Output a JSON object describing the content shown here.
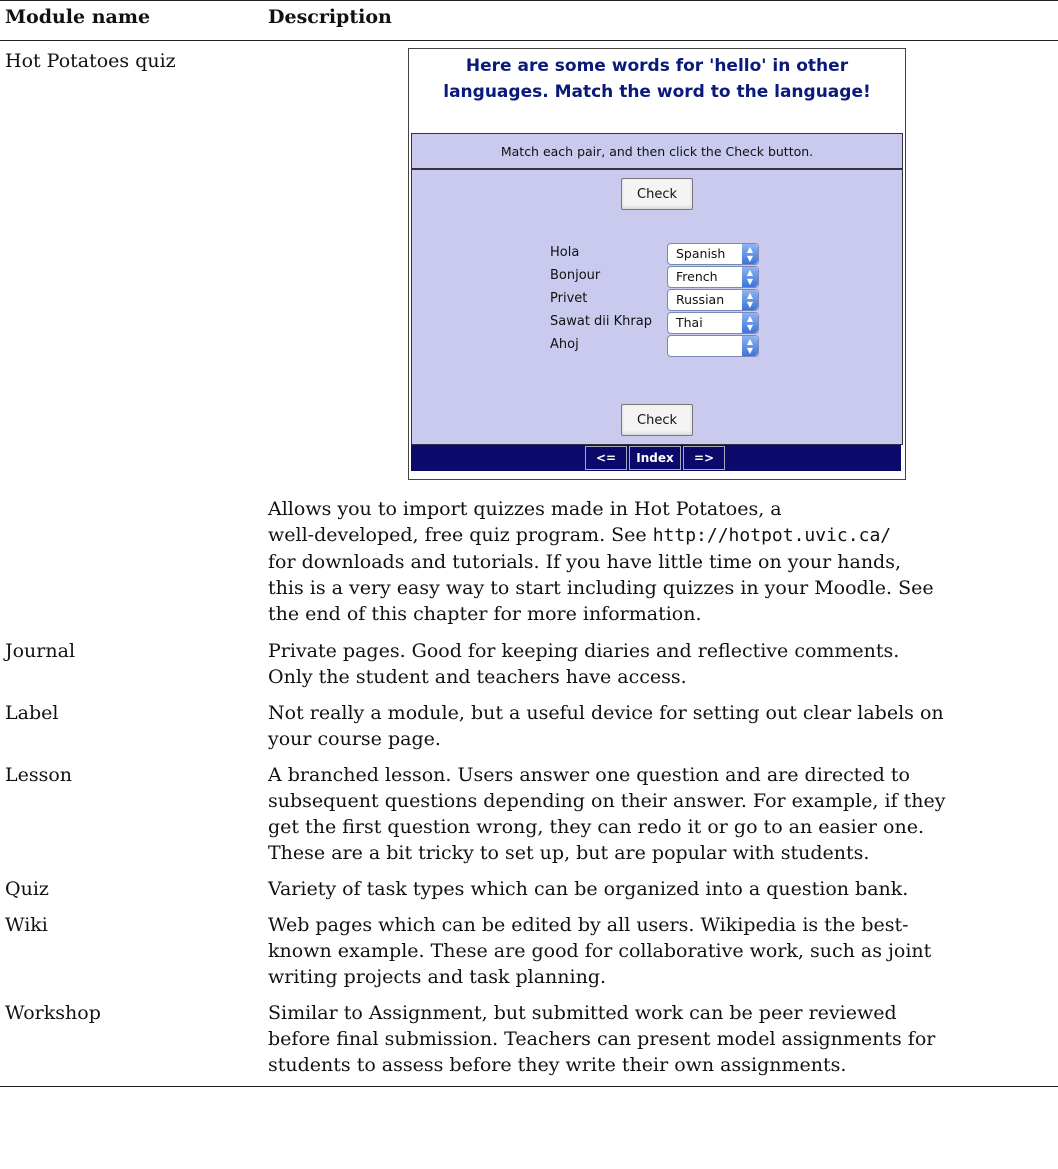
{
  "table": {
    "headers": {
      "name": "Module name",
      "description": "Description"
    },
    "rows": [
      {
        "name": "Hot Potatoes quiz",
        "lines": [
          "Allows you to import quizzes made in Hot Potatoes, a",
          "well-developed, free quiz program. See ",
          "http://hotpot.uvic.ca/",
          "for downloads and tutorials. If you have little time on your hands,",
          "this is a very easy way to start including quizzes in your Moodle. See",
          "the end of this chapter for more information."
        ]
      },
      {
        "name": "Journal",
        "lines": [
          "Private pages. Good for keeping diaries and reflective comments.",
          "Only the student and teachers have access."
        ]
      },
      {
        "name": "Label",
        "lines": [
          "Not really a module, but a useful device for setting out clear labels on",
          "your course page."
        ]
      },
      {
        "name": "Lesson",
        "lines": [
          "A branched lesson. Users answer one question and are directed to",
          "subsequent questions depending on their answer. For example, if they",
          "get the first question wrong, they can redo it or go to an easier one.",
          "These are a bit tricky to set up, but are popular with students."
        ]
      },
      {
        "name": "Quiz",
        "lines": [
          "Variety of task types which can be organized into a question bank."
        ]
      },
      {
        "name": "Wiki",
        "lines": [
          "Web pages which can be edited by all users. Wikipedia is the best-",
          "known example. These are good for collaborative work, such as joint",
          "writing projects and task planning."
        ]
      },
      {
        "name": "Workshop",
        "lines": [
          "Similar to Assignment, but submitted work can be peer reviewed",
          "before final submission. Teachers can present model assignments for",
          "students to assess before they write their own assignments."
        ]
      }
    ]
  },
  "hotpotatoes": {
    "title_line1": "Here are some words for 'hello' in other",
    "title_line2": "languages. Match the word to the language!",
    "instructions": "Match each pair, and then click the Check button.",
    "check_label": "Check",
    "pairs": [
      {
        "word": "Hola",
        "selected": "Spanish"
      },
      {
        "word": "Bonjour",
        "selected": "French"
      },
      {
        "word": "Privet",
        "selected": "Russian"
      },
      {
        "word": "Sawat dii Khrap",
        "selected": "Thai"
      },
      {
        "word": "Ahoj",
        "selected": ""
      }
    ],
    "nav": {
      "prev": "<=",
      "index": "Index",
      "next": "=>"
    },
    "colors": {
      "panel": "#c9caee",
      "nav_bar": "#0b0a6b",
      "title": "#0a1a7a"
    }
  }
}
